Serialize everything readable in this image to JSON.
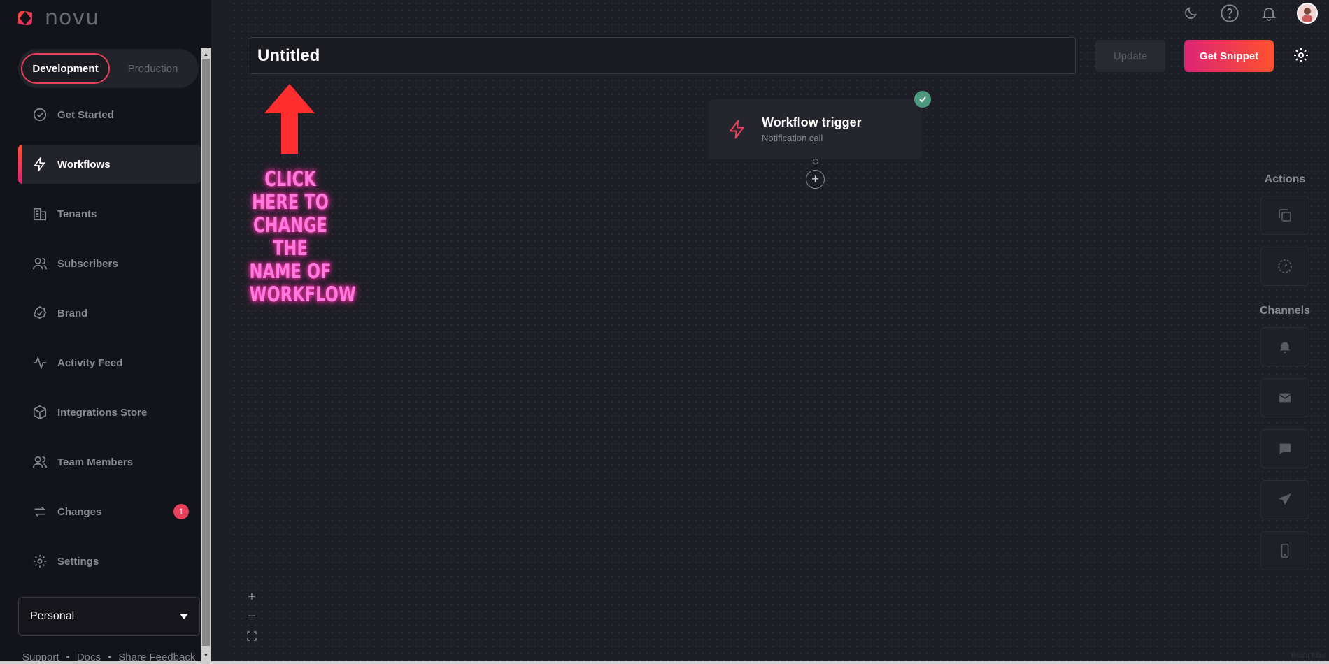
{
  "app": {
    "brand": "novu"
  },
  "env": {
    "dev": "Development",
    "prod": "Production"
  },
  "nav": {
    "items": [
      {
        "label": "Get Started",
        "icon": "check-circle-icon"
      },
      {
        "label": "Workflows",
        "icon": "bolt-icon",
        "active": true
      },
      {
        "label": "Tenants",
        "icon": "building-icon"
      },
      {
        "label": "Subscribers",
        "icon": "users-icon"
      },
      {
        "label": "Brand",
        "icon": "badge-check-icon"
      },
      {
        "label": "Activity Feed",
        "icon": "activity-icon"
      },
      {
        "label": "Integrations Store",
        "icon": "box-icon"
      },
      {
        "label": "Team Members",
        "icon": "team-icon"
      },
      {
        "label": "Changes",
        "icon": "sync-icon",
        "badge": "1"
      },
      {
        "label": "Settings",
        "icon": "gear-icon"
      }
    ]
  },
  "org": {
    "name": "Personal"
  },
  "footer": {
    "support": "Support",
    "docs": "Docs",
    "feedback": "Share Feedback",
    "sep": "•"
  },
  "editor": {
    "name_value": "Untitled",
    "update_label": "Update",
    "snippet_label": "Get Snippet"
  },
  "annotation": {
    "text": "CLICK HERE TO CHANGE THE NAME OF WORKFLOW"
  },
  "trigger": {
    "title": "Workflow trigger",
    "subtitle": "Notification call"
  },
  "panel": {
    "actions_title": "Actions",
    "channels_title": "Channels"
  },
  "attribution": "React Flow",
  "colors": {
    "accent": "#e8405a",
    "gradient_start": "#dd2476",
    "gradient_end": "#ff512f",
    "success": "#4d9980"
  }
}
